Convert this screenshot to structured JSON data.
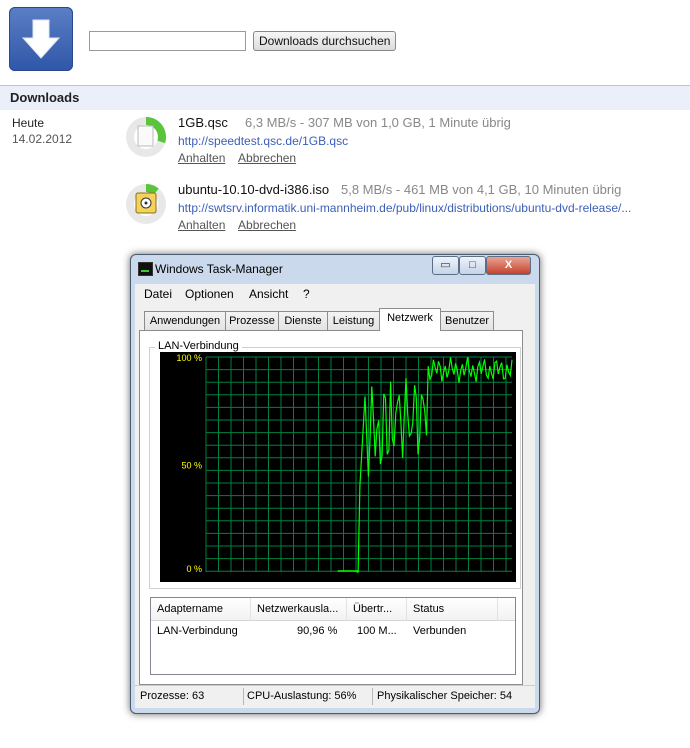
{
  "header": {
    "search_placeholder": "",
    "search_button": "Downloads durchsuchen"
  },
  "section": {
    "title": "Downloads"
  },
  "date": {
    "label": "Heute",
    "value": "14.02.2012"
  },
  "downloads": [
    {
      "name": "1GB.qsc",
      "status": "6,3 MB/s - 307 MB von 1,0 GB, 1 Minute übrig",
      "url": "http://speedtest.qsc.de/1GB.qsc",
      "pause": "Anhalten",
      "cancel": "Abbrechen",
      "progress": 0.3
    },
    {
      "name": "ubuntu-10.10-dvd-i386.iso",
      "status": "5,8 MB/s - 461 MB von 4,1 GB, 10 Minuten übrig",
      "url": "http://swtsrv.informatik.uni-mannheim.de/pub/linux/distributions/ubuntu-dvd-release/...",
      "pause": "Anhalten",
      "cancel": "Abbrechen",
      "progress": 0.11
    }
  ],
  "taskmanager": {
    "title": "Windows Task-Manager",
    "buttons": {
      "minimize": "▭",
      "maximize": "□",
      "close": "X"
    },
    "menu": [
      "Datei",
      "Optionen",
      "Ansicht",
      "?"
    ],
    "tabs": [
      "Anwendungen",
      "Prozesse",
      "Dienste",
      "Leistung",
      "Netzwerk",
      "Benutzer"
    ],
    "active_tab": "Netzwerk",
    "group_label": "LAN-Verbindung",
    "graph": {
      "y_labels": [
        "100 %",
        "50 %",
        "0 %"
      ]
    },
    "columns": [
      "Adaptername",
      "Netzwerkausla...",
      "Übertr...",
      "Status"
    ],
    "row": [
      "LAN-Verbindung",
      "90,96 %",
      "100 M...",
      "Verbunden"
    ],
    "status": {
      "processes": "Prozesse: 63",
      "cpu": "CPU-Auslastung: 56%",
      "memory": "Physikalischer Speicher: 54"
    },
    "colors": {
      "grid": "#008040",
      "line": "#00ff00",
      "axis_text": "#ffff00"
    }
  }
}
